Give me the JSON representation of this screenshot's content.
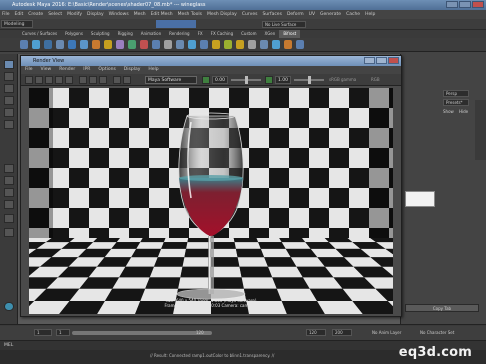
{
  "app": {
    "title": "Autodesk Maya 2016: E:\\Basic\\Render\\scenes\\shader07_08.mb* --- wineglass",
    "menu": [
      "File",
      "Edit",
      "Create",
      "Select",
      "Modify",
      "Display",
      "Windows",
      "Mesh",
      "Edit Mesh",
      "Mesh Tools",
      "Mesh Display",
      "Curves",
      "Surfaces",
      "Deform",
      "UV",
      "Generate",
      "Cache",
      "Help"
    ],
    "mode": "Modeling",
    "no_live_surface": "No Live Surface",
    "shelf_tabs": [
      "Curves / Surfaces",
      "Polygons",
      "Sculpting",
      "Rigging",
      "Animation",
      "Rendering",
      "FX",
      "FX Caching",
      "Custom",
      "XGen",
      "Bifrost"
    ],
    "active_shelf_tab": "Bifrost",
    "command_line": "MEL",
    "help_line": "// Result: Connected ramp1.outColor to blinn1.transparency. //",
    "time": {
      "start": "1",
      "end": "120",
      "current": "1.00",
      "range_end": "200"
    },
    "right_panel": {
      "persp": "Persp",
      "presets": "Presets*",
      "show": "Show",
      "hide": "Hide",
      "no_anim_layer": "No Anim Layer",
      "no_char_set": "No Character Set",
      "copy_tab": "Copy Tab"
    }
  },
  "render_view": {
    "title": "Render View",
    "menu": [
      "File",
      "View",
      "Render",
      "IPR",
      "Options",
      "Display",
      "Help"
    ],
    "camera": "Maya Software",
    "exposure": "0.00",
    "gamma": "1.00",
    "view_transform": "sRGB gamma",
    "frame_type": "RGB",
    "info_line1": "size: 640 x 540  zoom: 1.000        (Maya Software)",
    "info_line2": "Frame: 1     Render Time: 0:03        Camera: camera1"
  },
  "watermark": "eq3d.com",
  "colors": {
    "maya_bg": "#444444",
    "title_blue": "#6d8fb5",
    "checker_light": "#e8e8e8",
    "checker_dark": "#141414",
    "wine_red": "#8a0b1e"
  }
}
